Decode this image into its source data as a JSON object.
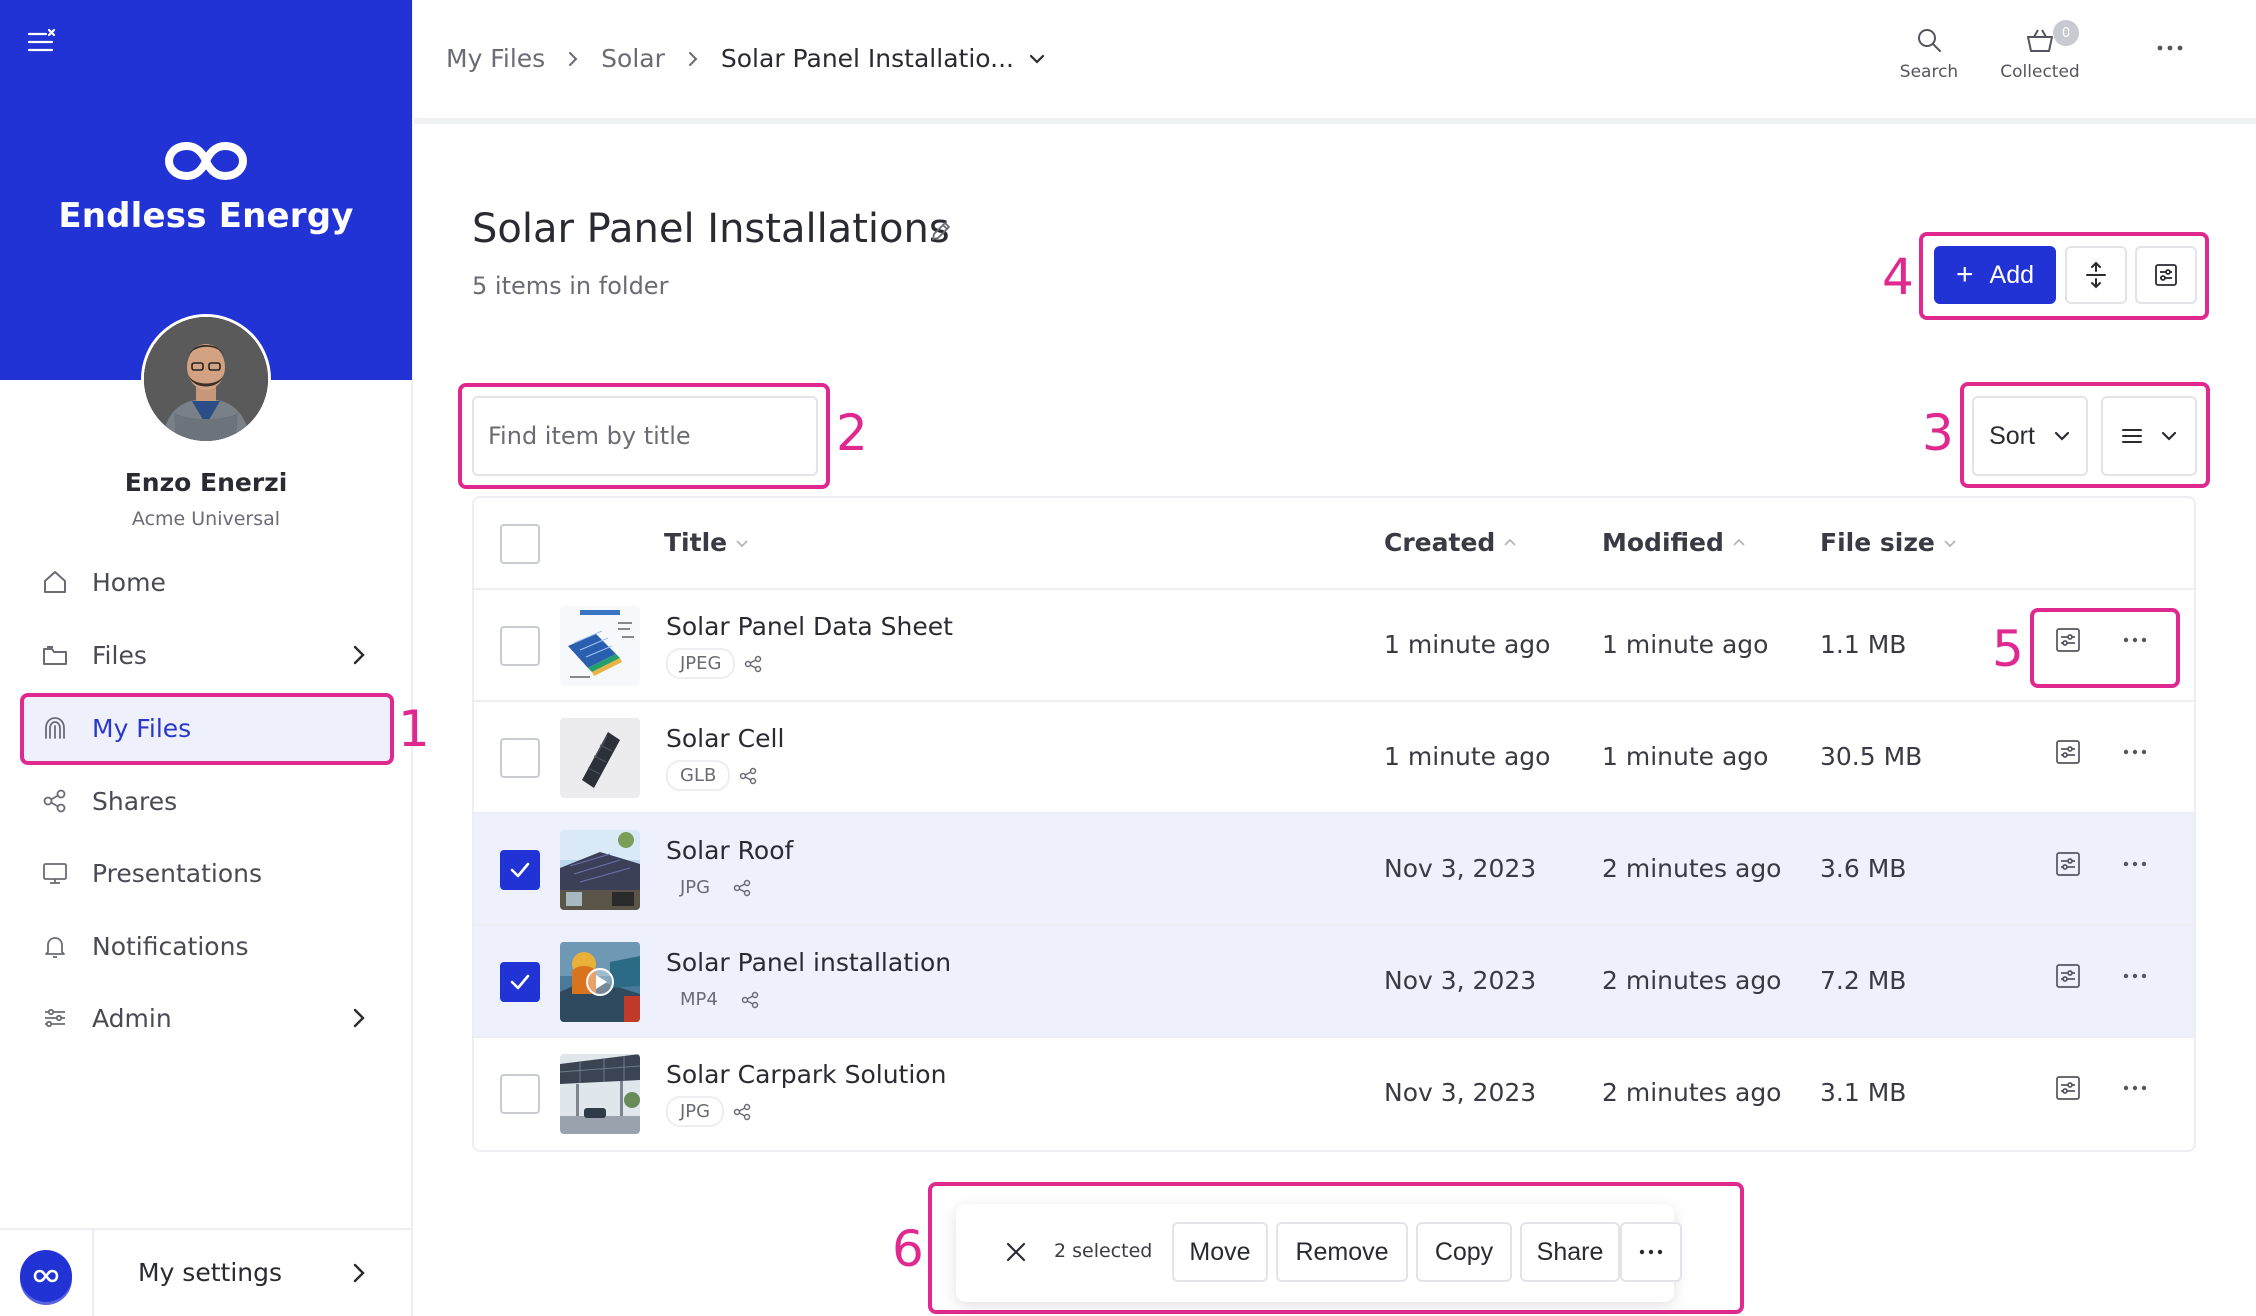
{
  "brand": {
    "name": "Endless Energy",
    "accent": "#2233d6",
    "highlight": "#e0298f"
  },
  "user": {
    "name": "Enzo Enerzi",
    "org": "Acme Universal"
  },
  "nav": [
    {
      "label": "Home",
      "icon": "home-icon"
    },
    {
      "label": "Files",
      "icon": "folder-icon",
      "chevron": true
    },
    {
      "label": "My Files",
      "icon": "fingerprint-icon",
      "active": true
    },
    {
      "label": "Shares",
      "icon": "share-icon"
    },
    {
      "label": "Presentations",
      "icon": "monitor-icon"
    },
    {
      "label": "Notifications",
      "icon": "bell-icon"
    },
    {
      "label": "Admin",
      "icon": "sliders-icon",
      "chevron": true
    }
  ],
  "settings": {
    "label": "My settings"
  },
  "breadcrumb": [
    "My Files",
    "Solar",
    "Solar Panel Installatio..."
  ],
  "topbar": {
    "search_label": "Search",
    "collected_label": "Collected",
    "collected_count": "0"
  },
  "folder": {
    "title": "Solar Panel Installations",
    "subtitle": "5 items in folder"
  },
  "toolbar": {
    "add_label": "Add",
    "search_placeholder": "Find item by title",
    "sort_label": "Sort"
  },
  "table": {
    "headers": {
      "title": "Title",
      "created": "Created",
      "modified": "Modified",
      "size": "File size"
    },
    "rows": [
      {
        "title": "Solar Panel Data Sheet",
        "type": "JPEG",
        "created": "1 minute ago",
        "modified": "1 minute ago",
        "size": "1.1 MB",
        "selected": false
      },
      {
        "title": "Solar Cell",
        "type": "GLB",
        "created": "1 minute ago",
        "modified": "1 minute ago",
        "size": "30.5 MB",
        "selected": false
      },
      {
        "title": "Solar Roof",
        "type": "JPG",
        "created": "Nov 3, 2023",
        "modified": "2 minutes ago",
        "size": "3.6 MB",
        "selected": true
      },
      {
        "title": "Solar Panel installation",
        "type": "MP4",
        "created": "Nov 3, 2023",
        "modified": "2 minutes ago",
        "size": "7.2 MB",
        "selected": true
      },
      {
        "title": "Solar Carpark Solution",
        "type": "JPG",
        "created": "Nov 3, 2023",
        "modified": "2 minutes ago",
        "size": "3.1 MB",
        "selected": false
      }
    ]
  },
  "selection": {
    "count_label": "2 selected",
    "actions": [
      "Move",
      "Remove",
      "Copy",
      "Share"
    ]
  },
  "callouts": [
    "1",
    "2",
    "3",
    "4",
    "5",
    "6"
  ]
}
